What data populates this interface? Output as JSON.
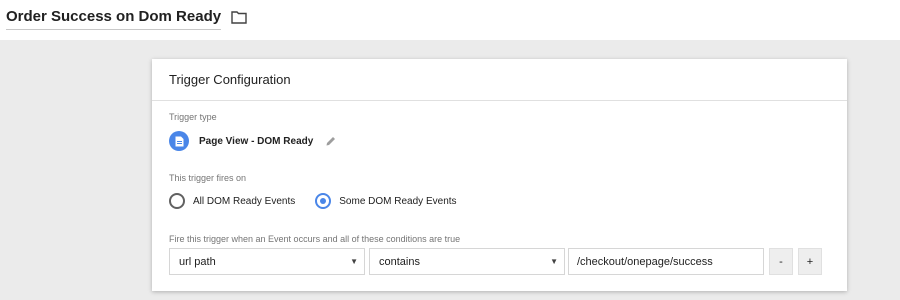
{
  "header": {
    "title": "Order Success on Dom Ready",
    "folder_icon": "folder-icon"
  },
  "card": {
    "heading": "Trigger Configuration",
    "trigger_type_label": "Trigger type",
    "trigger_type": {
      "name": "Page View - DOM Ready",
      "icon": "page-icon",
      "edit_icon": "pencil-icon",
      "badge_color": "#4a86e8"
    },
    "fires_on_label": "This trigger fires on",
    "fires_on_options": [
      {
        "label": "All DOM Ready Events",
        "selected": false
      },
      {
        "label": "Some DOM Ready Events",
        "selected": true
      }
    ],
    "conditions_label": "Fire this trigger when an Event occurs and all of these conditions are true",
    "condition": {
      "variable": "url path",
      "operator": "contains",
      "value": "/checkout/onepage/success"
    },
    "remove_label": "-",
    "add_label": "+"
  },
  "colors": {
    "accent": "#4a86e8",
    "background": "#ebebeb"
  }
}
